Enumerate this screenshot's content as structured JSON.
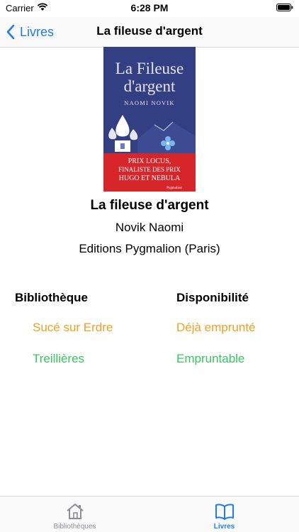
{
  "status_bar": {
    "carrier": "Carrier",
    "time": "6:28 PM"
  },
  "nav": {
    "back_label": "Livres",
    "title": "La fileuse d'argent"
  },
  "cover": {
    "title_line1": "La Fileuse",
    "title_line2": "d'argent",
    "author": "NAOMI NOVIK",
    "banner_line1": "PRIX LOCUS,",
    "banner_line2": "FINALISTE DES PRIX",
    "banner_line3": "HUGO ET NEBULA",
    "publisher_mark": "Pygmalion"
  },
  "book": {
    "title": "La fileuse d'argent",
    "author": "Novik Naomi",
    "publisher": "Editions Pygmalion (Paris)"
  },
  "table": {
    "headers": {
      "library": "Bibliothèque",
      "availability": "Disponibilité"
    },
    "rows": [
      {
        "library": "Sucé sur Erdre",
        "availability": "Déjà emprunté",
        "status_color": "#f0a020"
      },
      {
        "library": "Treillières",
        "availability": "Empruntable",
        "status_color": "#34c759"
      }
    ]
  },
  "tabs": [
    {
      "label": "Bibliothèques",
      "icon": "house-icon",
      "selected": false
    },
    {
      "label": "Livres",
      "icon": "book-icon",
      "selected": true
    }
  ],
  "colors": {
    "accent": "#1e7cf2",
    "borrowed": "#f0a020",
    "available": "#34c759"
  }
}
